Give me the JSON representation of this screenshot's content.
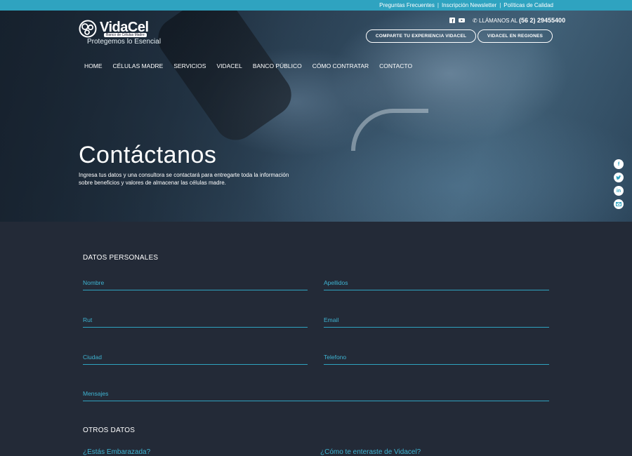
{
  "topbar": {
    "links": [
      "Preguntas Frecuentes",
      "Inscripción Newsletter",
      "Políticas de Calidad"
    ]
  },
  "header": {
    "logo": {
      "name": "VidaCel",
      "sub": "Banco de Células Madre",
      "slogan": "Protegemos lo Esencial"
    },
    "social": [
      "facebook-icon",
      "youtube-icon"
    ],
    "phone_prefix": "LLÁMANOS AL",
    "phone_number": "(56 2) 29455400",
    "buttons": {
      "share": "COMPARTE TU EXPERIENCIA VIDACEL",
      "regions": "VIDACEL EN REGIONES"
    },
    "nav": [
      "HOME",
      "CÉLULAS MADRE",
      "SERVICIOS",
      "VIDACEL",
      "BANCO PÚBLICO",
      "CÓMO CONTRATAR",
      "CONTACTO"
    ]
  },
  "hero": {
    "title": "Contáctanos",
    "text": "Ingresa tus datos y una consultora se contactará para entregarte toda la información sobre beneficios y valores de almacenar las células madre."
  },
  "side_icons": [
    "facebook-icon",
    "twitter-icon",
    "linkedin-icon",
    "email-icon"
  ],
  "form": {
    "personal_title": "DATOS PERSONALES",
    "fields": {
      "nombre": "Nombre",
      "apellidos": "Apellidos",
      "rut": "Rut",
      "email": "Email",
      "ciudad": "Ciudad",
      "telefono": "Telefono",
      "mensajes": "Mensajes"
    },
    "other_title": "OTROS DATOS",
    "questions": {
      "embarazada": "¿Estás Embarazada?",
      "enteraste": "¿Cómo te enteraste de Vidacel?"
    }
  },
  "colors": {
    "accent": "#2fa3c0",
    "background": "#232a37"
  }
}
